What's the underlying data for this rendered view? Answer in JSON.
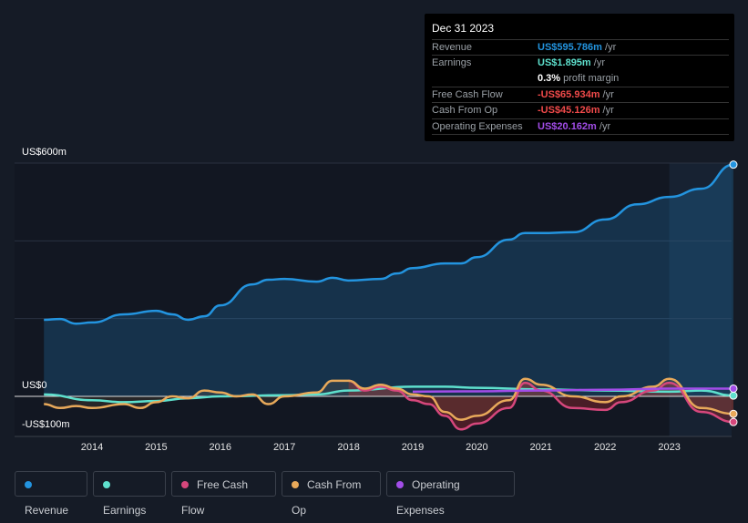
{
  "tooltip": {
    "date": "Dec 31 2023",
    "rows": [
      {
        "label": "Revenue",
        "value": "US$595.786m",
        "unit": " /yr",
        "color": "#2394df"
      },
      {
        "label": "Earnings",
        "value": "US$1.895m",
        "unit": " /yr",
        "color": "#5ee0cd"
      },
      {
        "label": "",
        "value": "0.3%",
        "unit": " profit margin",
        "color": "#ffffff"
      },
      {
        "label": "Free Cash Flow",
        "value": "-US$65.934m",
        "unit": " /yr",
        "color": "#f04a4a"
      },
      {
        "label": "Cash From Op",
        "value": "-US$45.126m",
        "unit": " /yr",
        "color": "#f04a4a"
      },
      {
        "label": "Operating Expenses",
        "value": "US$20.162m",
        "unit": " /yr",
        "color": "#a24de8"
      }
    ]
  },
  "chart_data": {
    "type": "line",
    "ylim": [
      -100,
      600
    ],
    "xlim": [
      2013.25,
      2024.0
    ],
    "y_tick_labels": [
      "US$600m",
      "US$0",
      "-US$100m"
    ],
    "x_tick_labels": [
      "2014",
      "2015",
      "2016",
      "2017",
      "2018",
      "2019",
      "2020",
      "2021",
      "2022",
      "2023"
    ],
    "highlight_from": 2023,
    "series": [
      {
        "name": "Revenue",
        "color": "#2394df",
        "x": [
          2013.25,
          2013.5,
          2013.75,
          2014,
          2014.5,
          2015,
          2015.25,
          2015.5,
          2015.75,
          2016,
          2016.5,
          2016.75,
          2017,
          2017.5,
          2017.75,
          2018,
          2018.5,
          2018.75,
          2019,
          2019.5,
          2019.75,
          2020,
          2020.5,
          2020.75,
          2021,
          2021.5,
          2022,
          2022.5,
          2023,
          2023.5,
          2024
        ],
        "y": [
          197,
          199,
          187,
          190,
          211,
          220,
          211,
          197,
          206,
          234,
          288,
          300,
          302,
          295,
          305,
          298,
          302,
          316,
          330,
          342,
          342,
          358,
          403,
          420,
          420,
          422,
          455,
          494,
          513,
          534,
          596
        ]
      },
      {
        "name": "Earnings",
        "color": "#5ee0cd",
        "x": [
          2013.25,
          2014,
          2014.5,
          2015,
          2015.5,
          2016,
          2017,
          2017.5,
          2018,
          2019,
          2019.5,
          2020,
          2021,
          2022,
          2023,
          2023.5,
          2024
        ],
        "y": [
          5,
          -10,
          -15,
          -12,
          -5,
          0,
          3,
          5,
          15,
          25,
          25,
          22,
          18,
          15,
          12,
          15,
          2
        ]
      },
      {
        "name": "Free Cash Flow",
        "color": "#d6477c",
        "x": [
          2018,
          2018.25,
          2018.5,
          2018.75,
          2019,
          2019.25,
          2019.5,
          2019.75,
          2020,
          2020.5,
          2020.75,
          2021,
          2021.5,
          2022,
          2022.25,
          2022.75,
          2023,
          2023.5,
          2024
        ],
        "y": [
          40,
          15,
          25,
          15,
          -10,
          -20,
          -50,
          -85,
          -70,
          -30,
          35,
          15,
          -30,
          -35,
          -15,
          15,
          35,
          -40,
          -66
        ]
      },
      {
        "name": "Cash From Op",
        "color": "#e8a95a",
        "x": [
          2013.25,
          2013.5,
          2013.75,
          2014,
          2014.5,
          2014.75,
          2015,
          2015.25,
          2015.5,
          2015.75,
          2016,
          2016.25,
          2016.5,
          2016.75,
          2017,
          2017.5,
          2017.75,
          2018,
          2018.25,
          2018.5,
          2018.75,
          2019,
          2019.25,
          2019.5,
          2019.75,
          2020,
          2020.5,
          2020.75,
          2021,
          2021.5,
          2022,
          2022.25,
          2022.75,
          2023,
          2023.5,
          2024
        ],
        "y": [
          -20,
          -30,
          -25,
          -30,
          -20,
          -30,
          -15,
          0,
          -5,
          15,
          10,
          0,
          5,
          -20,
          0,
          10,
          40,
          40,
          20,
          30,
          20,
          5,
          0,
          -40,
          -60,
          -50,
          -10,
          45,
          30,
          0,
          -15,
          0,
          25,
          45,
          -30,
          -45
        ]
      },
      {
        "name": "Operating Expenses",
        "color": "#a24de8",
        "x": [
          2019,
          2020,
          2021,
          2022,
          2023,
          2024
        ],
        "y": [
          12,
          13,
          15,
          17,
          20,
          20
        ]
      }
    ]
  },
  "legend": [
    "Revenue",
    "Earnings",
    "Free Cash Flow",
    "Cash From Op",
    "Operating Expenses"
  ]
}
